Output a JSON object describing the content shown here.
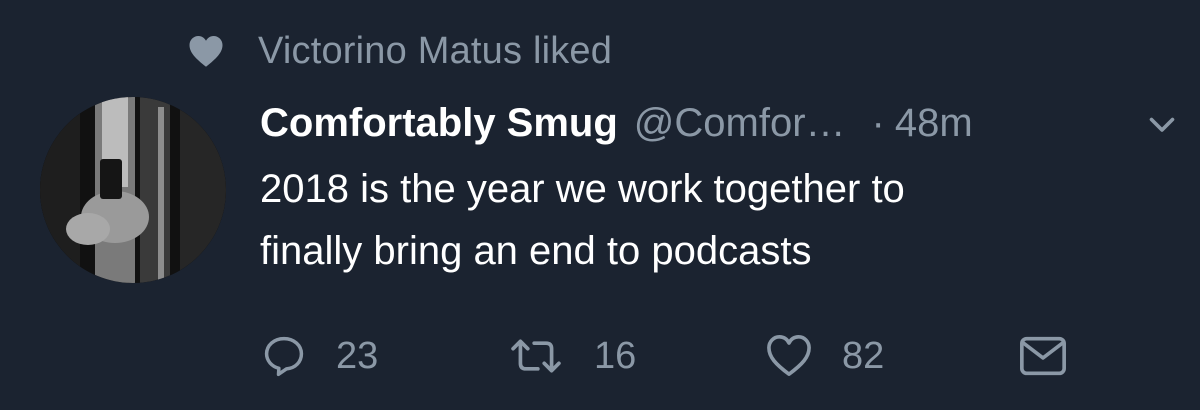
{
  "social_context": {
    "text": "Victorino Matus liked",
    "icon": "heart-icon"
  },
  "tweet": {
    "display_name": "Comfortably Smug",
    "handle": "@Comfor…",
    "separator": "·",
    "time": "48m",
    "text_lines": [
      "2018 is the year we work together to",
      "finally bring an end to podcasts"
    ]
  },
  "actions": {
    "reply_count": "23",
    "retweet_count": "16",
    "like_count": "82"
  },
  "colors": {
    "background": "#1b2330",
    "secondary_text": "#8b98a6",
    "primary_text": "#ffffff"
  }
}
